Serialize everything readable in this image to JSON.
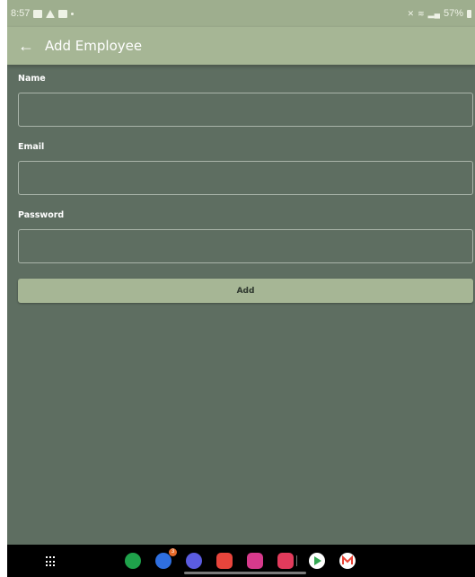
{
  "status_bar": {
    "time": "8:57",
    "battery": "57%",
    "icons": [
      "image-icon",
      "warning-icon",
      "message-icon",
      "mute-icon",
      "wifi-icon",
      "signal-icon"
    ]
  },
  "app_bar": {
    "back_icon": "arrow-left-icon",
    "back_glyph": "←",
    "title": "Add Employee"
  },
  "form": {
    "fields": [
      {
        "label": "Name",
        "value": "",
        "placeholder": ""
      },
      {
        "label": "Email",
        "value": "",
        "placeholder": ""
      },
      {
        "label": "Password",
        "value": "",
        "placeholder": ""
      }
    ],
    "submit_label": "Add"
  },
  "dock": {
    "badge_count": "3",
    "apps": [
      {
        "name": "phone-app-icon",
        "color": "#1fa24b"
      },
      {
        "name": "messages-app-icon",
        "color": "#2f6fe0"
      },
      {
        "name": "internet-app-icon",
        "color": "#5b5ce0"
      },
      {
        "name": "notes-app-icon",
        "color": "#e8453c"
      },
      {
        "name": "gallery-app-icon",
        "color": "#d73a8c"
      },
      {
        "name": "camera-app-icon",
        "color": "#e23b5c"
      },
      {
        "name": "play-store-app-icon",
        "color": "#ffffff"
      },
      {
        "name": "gmail-app-icon",
        "color": "#ffffff"
      }
    ]
  },
  "colors": {
    "background": "#5e6e61",
    "app_bar": "#a6b695",
    "button": "#a6b695"
  }
}
